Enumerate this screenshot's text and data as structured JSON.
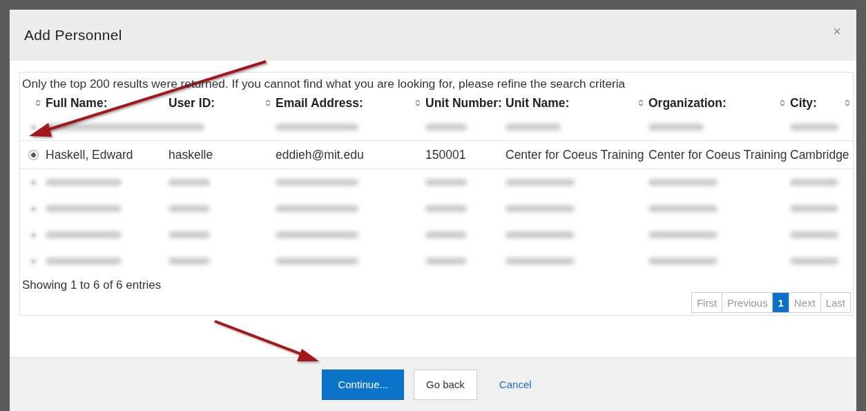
{
  "dialog": {
    "title": "Add Personnel",
    "close": "×"
  },
  "notice": "Only the top 200 results were returned. If you cannot find what you are looking for, please refine the search criteria",
  "columns": [
    {
      "sort_icon": true
    },
    {
      "label": "Full Name:",
      "sort_icon": false
    },
    {
      "label": "User ID:",
      "sort_icon": true
    },
    {
      "label": "Email Address:",
      "sort_icon": true
    },
    {
      "label": "Unit Number:",
      "sort_icon": false
    },
    {
      "label": "Unit Name:",
      "sort_icon": true
    },
    {
      "label": "Organization:",
      "sort_icon": true
    },
    {
      "label": "City:",
      "sort_icon": true
    }
  ],
  "rows": [
    {
      "kind": "redacted",
      "selected": false
    },
    {
      "kind": "person",
      "selected": true,
      "cells": [
        "Haskell, Edward",
        "haskelle",
        "eddieh@mit.edu",
        "150001",
        "Center for Coeus Training",
        "Center for Coeus Training",
        "Cambridge"
      ]
    },
    {
      "kind": "redacted",
      "selected": false
    },
    {
      "kind": "redacted",
      "selected": false
    },
    {
      "kind": "redacted",
      "selected": false
    },
    {
      "kind": "redacted",
      "selected": false
    }
  ],
  "summary": "Showing 1 to 6 of 6 entries",
  "pagination": [
    {
      "label": "First",
      "selected": false
    },
    {
      "label": "Previous",
      "selected": false
    },
    {
      "label": "1",
      "selected": true
    },
    {
      "label": "Next",
      "selected": false
    },
    {
      "label": "Last",
      "selected": false
    }
  ],
  "buttons": [
    {
      "kind": "primary",
      "label": "Continue..."
    },
    {
      "kind": "default",
      "label": "Go back"
    },
    {
      "kind": "link",
      "label": "Cancel"
    }
  ]
}
